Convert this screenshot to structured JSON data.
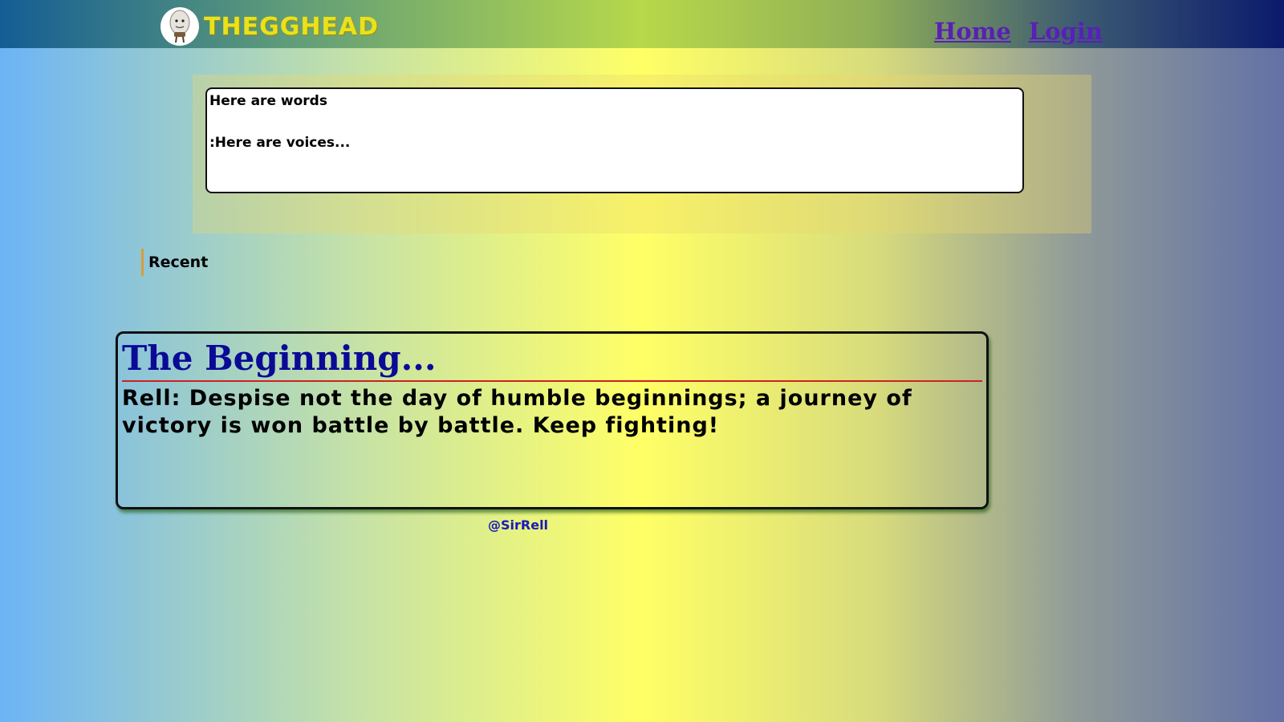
{
  "header": {
    "brand": "THEGGHEAD",
    "logo_icon": "egg-head-logo-icon",
    "nav": [
      {
        "label": "Home"
      },
      {
        "label": "Login"
      }
    ]
  },
  "composer": {
    "value": "Here are words\n\n:Here are voices..."
  },
  "recent": {
    "label": "Recent"
  },
  "posts": [
    {
      "title": "The Beginning...",
      "body": "Rell: Despise not the day of humble beginnings; a journey of victory is won battle by battle. Keep fighting!",
      "author": "@SirRell"
    }
  ],
  "colors": {
    "brand": "#e9e11c",
    "nav_link": "#5a1fb6",
    "post_title": "#0b0a96",
    "title_rule": "#cc2222",
    "author_link": "#1a1ab8"
  }
}
